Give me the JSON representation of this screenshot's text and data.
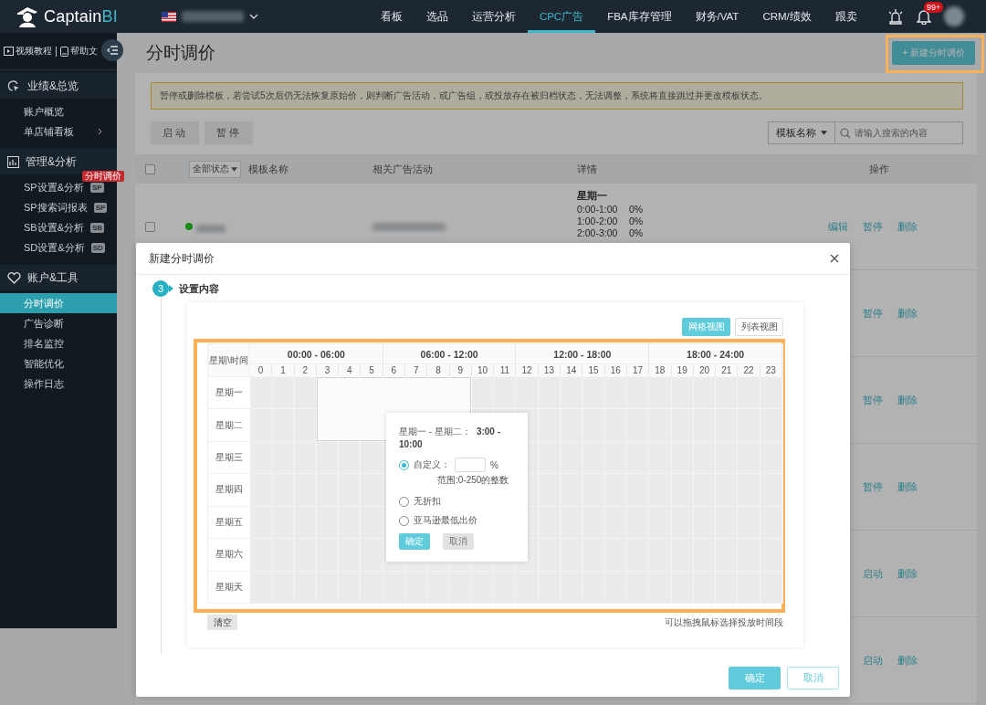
{
  "top_nav": {
    "logo": {
      "name": "Captain",
      "accent": "BI"
    },
    "menu": [
      {
        "label": "看板",
        "selected": false
      },
      {
        "label": "选品",
        "selected": false
      },
      {
        "label": "运营分析",
        "selected": false
      },
      {
        "label": "CPC广告",
        "selected": true
      },
      {
        "label": "FBA库存管理",
        "selected": false
      },
      {
        "label": "财务/VAT",
        "selected": false
      },
      {
        "label": "CRM/绩效",
        "selected": false
      },
      {
        "label": "跟卖",
        "selected": false
      }
    ],
    "notifications": "99+"
  },
  "sidebar": {
    "help_links": [
      {
        "kind": "video",
        "label": "视频教程"
      },
      {
        "kind": "document",
        "label": "帮助文"
      }
    ],
    "sections": [
      {
        "kind": "performance",
        "title": "业绩&总览",
        "items": [
          {
            "label": "账户概览",
            "selected": false,
            "expandable": false
          },
          {
            "label": "单店铺看板",
            "selected": false,
            "expandable": true
          }
        ]
      },
      {
        "kind": "analysis",
        "title": "管理&分析",
        "items": [
          {
            "label": "SP设置&分析",
            "selected": false,
            "expandable": false,
            "tag": "SP",
            "badge": "分时调价"
          },
          {
            "label": "SP搜索词报表",
            "selected": false,
            "expandable": false,
            "tag": "SP"
          },
          {
            "label": "SB设置&分析",
            "selected": false,
            "expandable": false,
            "tag": "SB"
          },
          {
            "label": "SD设置&分析",
            "selected": false,
            "expandable": false,
            "tag": "SD"
          }
        ]
      },
      {
        "kind": "tools",
        "title": "账户&工具",
        "items": [
          {
            "label": "分时调价",
            "selected": true,
            "expandable": false
          },
          {
            "label": "广告诊断",
            "selected": false,
            "expandable": false
          },
          {
            "label": "排名监控",
            "selected": false,
            "expandable": false
          },
          {
            "label": "智能优化",
            "selected": false,
            "expandable": false
          },
          {
            "label": "操作日志",
            "selected": false,
            "expandable": false
          }
        ]
      }
    ]
  },
  "page": {
    "title": "分时调价",
    "new_button": "+ 新建分时调价",
    "notice": "暂停或删除模板，若尝试5次后仍无法恢复原始价，则判断广告活动，或广告组，或投放存在被归档状态，无法调整，系统将直接跳过并更改模板状态。",
    "bulk_actions": [
      "启动",
      "暂停"
    ],
    "search": {
      "filter": "模板名称",
      "placeholder": "请输入搜索的内容"
    },
    "table": {
      "status_filter": "全部状态",
      "columns": [
        "模板名称",
        "相关广告活动",
        "详情",
        "操作"
      ],
      "select_all": {
        "checked": false
      },
      "rows": [
        {
          "checked": false,
          "color": "#168a16",
          "redacted": true,
          "details_title": "星期一",
          "details": [
            {
              "time": "0:00-1:00",
              "value": "0%"
            },
            {
              "time": "1:00-2:00",
              "value": "0%"
            },
            {
              "time": "2:00-3:00",
              "value": "0%"
            }
          ],
          "actions": [
            "编辑",
            "暂停",
            "删除"
          ]
        },
        {
          "actions": [
            "暂停",
            "删除"
          ]
        },
        {
          "actions": [
            "暂停",
            "删除"
          ]
        },
        {
          "actions": [
            "暂停",
            "删除"
          ]
        },
        {
          "actions": [
            "启动",
            "删除"
          ]
        },
        {
          "actions": [
            "启动",
            "删除"
          ]
        }
      ]
    }
  },
  "modal": {
    "title": "新建分时调价",
    "step": {
      "number": "3",
      "title": "设置内容"
    },
    "views": [
      {
        "label": "网格视图",
        "selected": true
      },
      {
        "label": "列表视图",
        "selected": false
      }
    ],
    "grid": {
      "corner": "星期\\时间",
      "hour_groups": [
        "00:00 - 06:00",
        "06:00 - 12:00",
        "12:00 - 18:00",
        "18:00 - 24:00"
      ],
      "hours": [
        "0",
        "1",
        "2",
        "3",
        "4",
        "5",
        "6",
        "7",
        "8",
        "9",
        "10",
        "11",
        "12",
        "13",
        "14",
        "15",
        "16",
        "17",
        "18",
        "19",
        "20",
        "21",
        "22",
        "23"
      ],
      "days": [
        {
          "label": "星期一",
          "slots": [
            {
              "selected": false
            },
            {
              "selected": false
            },
            {
              "selected": false
            },
            {
              "selected": true
            },
            {
              "selected": true
            },
            {
              "selected": true
            },
            {
              "selected": true
            },
            {
              "selected": true
            },
            {
              "selected": true
            },
            {
              "selected": true
            },
            {
              "selected": false
            },
            {
              "selected": false
            },
            {
              "selected": false
            },
            {
              "selected": false
            },
            {
              "selected": false
            },
            {
              "selected": false
            },
            {
              "selected": false
            },
            {
              "selected": false
            },
            {
              "selected": false
            },
            {
              "selected": false
            },
            {
              "selected": false
            },
            {
              "selected": false
            },
            {
              "selected": false
            },
            {
              "selected": false
            }
          ]
        },
        {
          "label": "星期二",
          "slots": [
            {
              "selected": false
            },
            {
              "selected": false
            },
            {
              "selected": false
            },
            {
              "selected": true
            },
            {
              "selected": true
            },
            {
              "selected": true
            },
            {
              "selected": true
            },
            {
              "selected": true
            },
            {
              "selected": true
            },
            {
              "selected": true
            },
            {
              "selected": false
            },
            {
              "selected": false
            },
            {
              "selected": false
            },
            {
              "selected": false
            },
            {
              "selected": false
            },
            {
              "selected": false
            },
            {
              "selected": false
            },
            {
              "selected": false
            },
            {
              "selected": false
            },
            {
              "selected": false
            },
            {
              "selected": false
            },
            {
              "selected": false
            },
            {
              "selected": false
            },
            {
              "selected": false
            }
          ]
        },
        {
          "label": "星期三",
          "slots": [
            {
              "selected": false
            },
            {
              "selected": false
            },
            {
              "selected": false
            },
            {
              "selected": false
            },
            {
              "selected": false
            },
            {
              "selected": false
            },
            {
              "selected": false
            }
          ],
          "slots_right": [
            {
              "selected": false
            },
            {
              "selected": false
            },
            {
              "selected": false
            },
            {
              "selected": false
            },
            {
              "selected": false
            },
            {
              "selected": false
            },
            {
              "selected": false
            },
            {
              "selected": false
            },
            {
              "selected": false
            },
            {
              "selected": false
            },
            {
              "selected": false
            },
            {
              "selected": false
            }
          ]
        },
        {
          "label": "星期四",
          "slots": [
            {
              "selected": false
            },
            {
              "selected": false
            },
            {
              "selected": false
            },
            {
              "selected": false
            },
            {
              "selected": false
            },
            {
              "selected": false
            },
            {
              "selected": false
            }
          ],
          "slots_right": [
            {
              "selected": false
            },
            {
              "selected": false
            },
            {
              "selected": false
            },
            {
              "selected": false
            },
            {
              "selected": false
            },
            {
              "selected": false
            },
            {
              "selected": false
            },
            {
              "selected": false
            },
            {
              "selected": false
            },
            {
              "selected": false
            },
            {
              "selected": false
            },
            {
              "selected": false
            }
          ]
        },
        {
          "label": "星期五",
          "slots": [
            {
              "selected": false
            },
            {
              "selected": false
            },
            {
              "selected": false
            },
            {
              "selected": false
            },
            {
              "selected": false
            },
            {
              "selected": false
            },
            {
              "selected": false
            }
          ],
          "slots_right": [
            {
              "selected": false
            },
            {
              "selected": false
            },
            {
              "selected": false
            },
            {
              "selected": false
            },
            {
              "selected": false
            },
            {
              "selected": false
            },
            {
              "selected": false
            },
            {
              "selected": false
            },
            {
              "selected": false
            },
            {
              "selected": false
            },
            {
              "selected": false
            },
            {
              "selected": false
            }
          ]
        },
        {
          "label": "星期六",
          "slots": [
            {
              "selected": false
            },
            {
              "selected": false
            },
            {
              "selected": false
            },
            {
              "selected": false
            },
            {
              "selected": false
            },
            {
              "selected": false
            },
            {
              "selected": false
            },
            {
              "selected": false
            },
            {
              "selected": false
            },
            {
              "selected": false
            },
            {
              "selected": false
            },
            {
              "selected": false
            },
            {
              "selected": false
            },
            {
              "selected": false
            },
            {
              "selected": false
            },
            {
              "selected": false
            },
            {
              "selected": false
            },
            {
              "selected": false
            },
            {
              "selected": false
            },
            {
              "selected": false
            },
            {
              "selected": false
            },
            {
              "selected": false
            },
            {
              "selected": false
            },
            {
              "selected": false
            }
          ]
        },
        {
          "label": "星期天",
          "slots": [
            {
              "selected": false
            },
            {
              "selected": false
            },
            {
              "selected": false
            },
            {
              "selected": false
            },
            {
              "selected": false
            },
            {
              "selected": false
            },
            {
              "selected": false
            },
            {
              "selected": false
            },
            {
              "selected": false
            },
            {
              "selected": false
            },
            {
              "selected": false
            },
            {
              "selected": false
            },
            {
              "selected": false
            },
            {
              "selected": false
            },
            {
              "selected": false
            },
            {
              "selected": false
            },
            {
              "selected": false
            },
            {
              "selected": false
            },
            {
              "selected": false
            },
            {
              "selected": false
            },
            {
              "selected": false
            },
            {
              "selected": false
            },
            {
              "selected": false
            },
            {
              "selected": false
            }
          ]
        }
      ]
    },
    "popup": {
      "range_label": "星期一 - 星期二：",
      "range_time": "3:00 - 10:00",
      "options": [
        {
          "kind": "custom",
          "label": "自定义：",
          "selected": true,
          "unit": "%",
          "hint": "范围:0-250的整数"
        },
        {
          "kind": "plain",
          "label": "无折扣",
          "selected": false
        },
        {
          "kind": "plain",
          "label": "亚马逊最低出价",
          "selected": false
        }
      ],
      "confirm": "确定",
      "cancel": {
        "label": "取消",
        "disabled": true
      }
    },
    "clear_button": "清空",
    "hint": "可以拖拽鼠标选择投放时间段",
    "buttons": {
      "confirm": "确定",
      "cancel": "取消"
    }
  }
}
